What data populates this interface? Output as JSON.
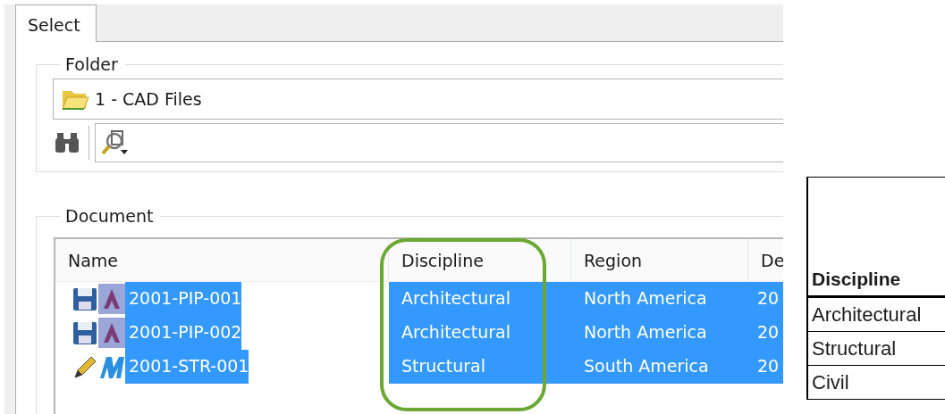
{
  "dialog": {
    "tabs": [
      {
        "label": "Select",
        "selected": true
      }
    ],
    "folder_group": {
      "label": "Folder",
      "folder": "1 - CAD Files"
    },
    "document_group": {
      "label": "Document",
      "columns": [
        "Name",
        "Discipline",
        "Region",
        "De"
      ],
      "rows": [
        {
          "kind": "saved",
          "name": "2001-PIP-001",
          "discipline": "Architectural",
          "region": "North America",
          "column_4": "20",
          "selected": true
        },
        {
          "kind": "saved",
          "name": "2001-PIP-002",
          "discipline": "Architectural",
          "region": "North America",
          "column_4": "20",
          "selected": true
        },
        {
          "kind": "edited",
          "name": "2001-STR-001",
          "discipline": "Structural",
          "region": "South America",
          "column_4": "20",
          "selected": true
        }
      ]
    }
  },
  "side_table": {
    "header": "Discipline",
    "rows": [
      "Architectural",
      "Structural",
      "Civil"
    ]
  }
}
